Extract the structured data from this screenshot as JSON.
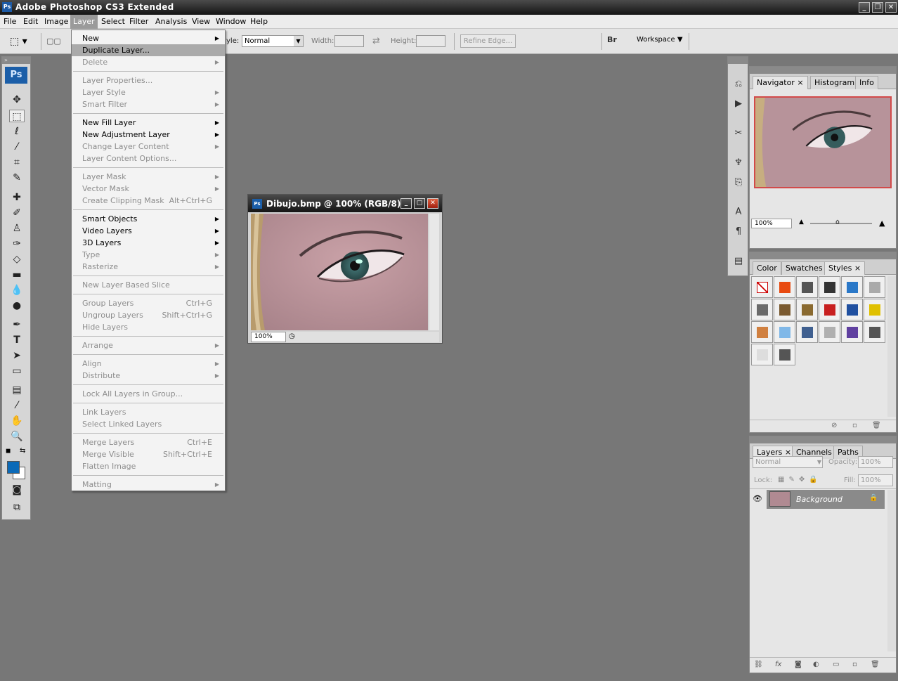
{
  "window": {
    "title": "Adobe Photoshop CS3 Extended",
    "app_icon": "Ps"
  },
  "menubar": [
    "File",
    "Edit",
    "Image",
    "Layer",
    "Select",
    "Filter",
    "Analysis",
    "View",
    "Window",
    "Help"
  ],
  "options": {
    "style_label": "yle:",
    "style_value": "Normal",
    "width_label": "Width:",
    "height_label": "Height:",
    "refine_edge": "Refine Edge...",
    "workspace": "Workspace"
  },
  "toolbox": {
    "logo": "Ps"
  },
  "layer_menu": [
    {
      "label": "New",
      "submenu": true
    },
    {
      "label": "Duplicate Layer...",
      "highlighted": true
    },
    {
      "label": "Delete",
      "disabled": true,
      "submenu": true
    },
    {
      "sep": true
    },
    {
      "label": "Layer Properties...",
      "disabled": true
    },
    {
      "label": "Layer Style",
      "disabled": true,
      "submenu": true
    },
    {
      "label": "Smart Filter",
      "disabled": true,
      "submenu": true
    },
    {
      "sep": true
    },
    {
      "label": "New Fill Layer",
      "submenu": true
    },
    {
      "label": "New Adjustment Layer",
      "submenu": true
    },
    {
      "label": "Change Layer Content",
      "disabled": true,
      "submenu": true
    },
    {
      "label": "Layer Content Options...",
      "disabled": true
    },
    {
      "sep": true
    },
    {
      "label": "Layer Mask",
      "disabled": true,
      "submenu": true
    },
    {
      "label": "Vector Mask",
      "disabled": true,
      "submenu": true
    },
    {
      "label": "Create Clipping Mask",
      "disabled": true,
      "shortcut": "Alt+Ctrl+G"
    },
    {
      "sep": true
    },
    {
      "label": "Smart Objects",
      "submenu": true
    },
    {
      "label": "Video Layers",
      "submenu": true
    },
    {
      "label": "3D Layers",
      "submenu": true
    },
    {
      "label": "Type",
      "disabled": true,
      "submenu": true
    },
    {
      "label": "Rasterize",
      "disabled": true,
      "submenu": true
    },
    {
      "sep": true
    },
    {
      "label": "New Layer Based Slice",
      "disabled": true
    },
    {
      "sep": true
    },
    {
      "label": "Group Layers",
      "disabled": true,
      "shortcut": "Ctrl+G"
    },
    {
      "label": "Ungroup Layers",
      "disabled": true,
      "shortcut": "Shift+Ctrl+G"
    },
    {
      "label": "Hide Layers",
      "disabled": true
    },
    {
      "sep": true
    },
    {
      "label": "Arrange",
      "disabled": true,
      "submenu": true
    },
    {
      "sep": true
    },
    {
      "label": "Align",
      "disabled": true,
      "submenu": true
    },
    {
      "label": "Distribute",
      "disabled": true,
      "submenu": true
    },
    {
      "sep": true
    },
    {
      "label": "Lock All Layers in Group...",
      "disabled": true
    },
    {
      "sep": true
    },
    {
      "label": "Link Layers",
      "disabled": true
    },
    {
      "label": "Select Linked Layers",
      "disabled": true
    },
    {
      "sep": true
    },
    {
      "label": "Merge Layers",
      "disabled": true,
      "shortcut": "Ctrl+E"
    },
    {
      "label": "Merge Visible",
      "disabled": true,
      "shortcut": "Shift+Ctrl+E"
    },
    {
      "label": "Flatten Image",
      "disabled": true
    },
    {
      "sep": true
    },
    {
      "label": "Matting",
      "disabled": true,
      "submenu": true
    }
  ],
  "document": {
    "title": "Dibujo.bmp @ 100% (RGB/8)",
    "zoom": "100%"
  },
  "navigator": {
    "tabs": [
      "Navigator",
      "Histogram",
      "Info"
    ],
    "zoom": "100%"
  },
  "styles_panel": {
    "tabs": [
      "Color",
      "Swatches",
      "Styles"
    ],
    "swatches": [
      "#ffffff",
      "#e84a10",
      "#555555",
      "#333333",
      "#2a78c8",
      "#aaaaaa",
      "#6a6a6a",
      "#7a5a30",
      "#8a6a30",
      "#c82020",
      "#2050a0",
      "#e0c000",
      "#d08040",
      "#80b8e8",
      "#406090",
      "#b0b0b0",
      "#6040a0",
      "#555555",
      "#dddddd",
      "#555555"
    ]
  },
  "layers_panel": {
    "tabs": [
      "Layers",
      "Channels",
      "Paths"
    ],
    "blend_mode": "Normal",
    "opacity_label": "Opacity:",
    "opacity": "100%",
    "lock_label": "Lock:",
    "fill_label": "Fill:",
    "fill": "100%",
    "layers": [
      {
        "name": "Background"
      }
    ]
  }
}
